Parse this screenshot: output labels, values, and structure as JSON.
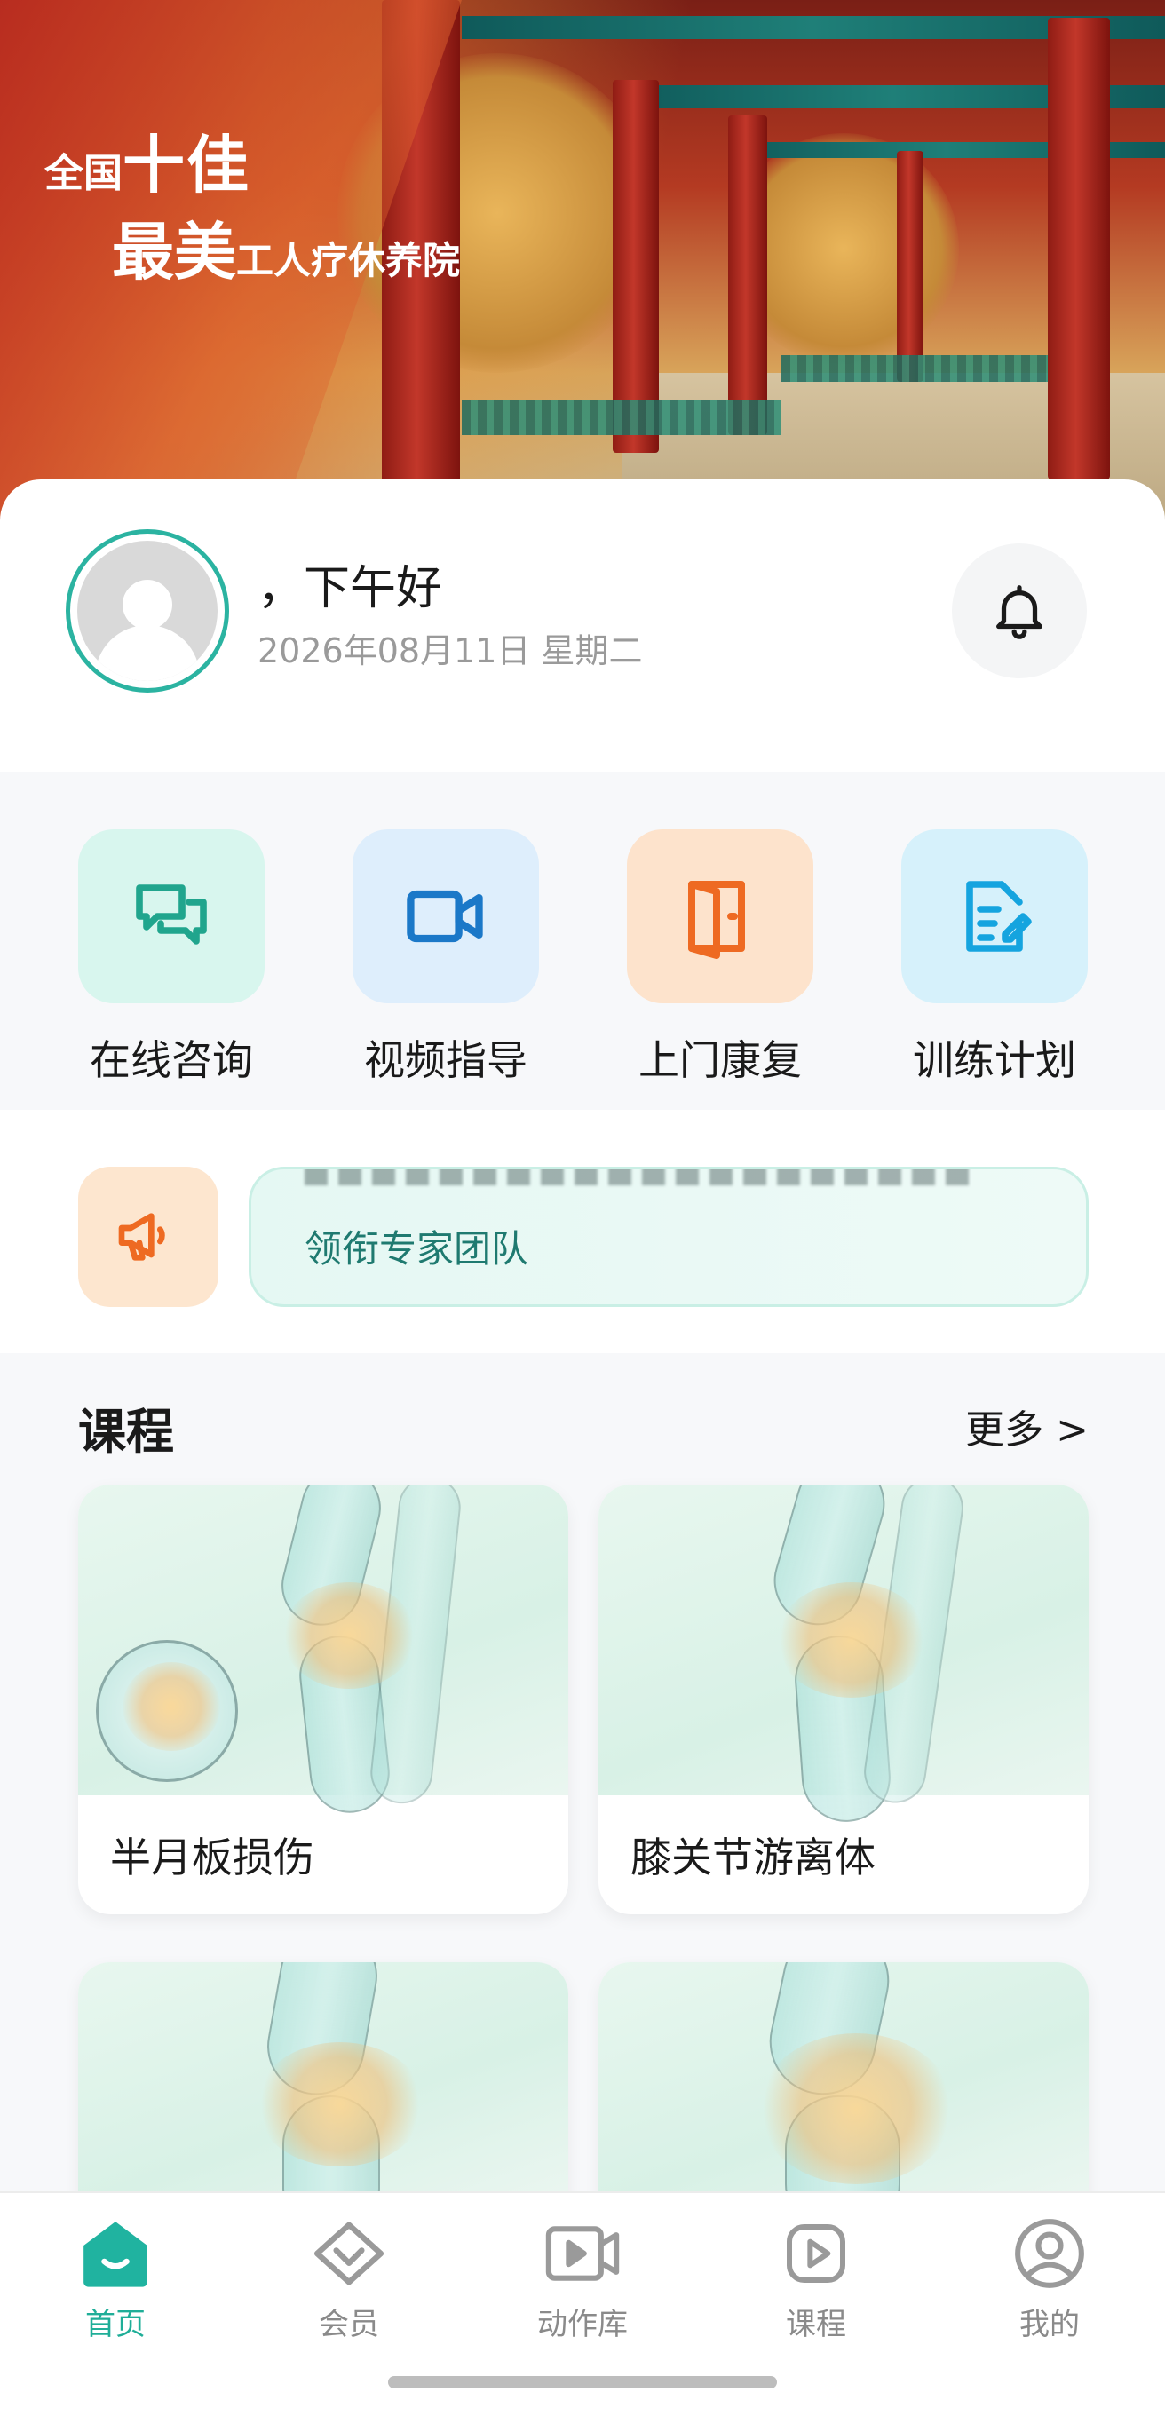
{
  "banner": {
    "line1_small": "全国",
    "line1_big": "十佳",
    "line2_big": "最美",
    "line2_small": "工人疗休养院"
  },
  "greeting": {
    "text": "，下午好",
    "date": "2026年08月11日 星期二"
  },
  "quick_actions": [
    {
      "label": "在线咨询",
      "icon": "chat-icon",
      "bg": "#d8f6ee",
      "color": "#20a58d"
    },
    {
      "label": "视频指导",
      "icon": "video-camera-icon",
      "bg": "#deeefc",
      "color": "#1b78c8"
    },
    {
      "label": "上门康复",
      "icon": "door-icon",
      "bg": "#fde3cc",
      "color": "#ee6a22"
    },
    {
      "label": "训练计划",
      "icon": "edit-document-icon",
      "bg": "#d6f1fb",
      "color": "#15a4df"
    }
  ],
  "notice": {
    "icon": "megaphone-icon",
    "text": "领衔专家团队"
  },
  "courses": {
    "title": "课程",
    "more": "更多 >",
    "items": [
      {
        "title": "半月板损伤",
        "image": "meniscus-injury-illustration"
      },
      {
        "title": "膝关节游离体",
        "image": "knee-loose-body-illustration"
      },
      {
        "title": "",
        "image": "knee-joint-illustration"
      },
      {
        "title": "",
        "image": "knee-arthritis-illustration"
      }
    ]
  },
  "tabbar": [
    {
      "label": "首页",
      "icon": "home-icon",
      "active": true
    },
    {
      "label": "会员",
      "icon": "member-diamond-icon",
      "active": false
    },
    {
      "label": "动作库",
      "icon": "video-library-icon",
      "active": false
    },
    {
      "label": "课程",
      "icon": "play-course-icon",
      "active": false
    },
    {
      "label": "我的",
      "icon": "profile-icon",
      "active": false
    }
  ],
  "colors": {
    "accent": "#1fae98",
    "avatar_ring": "#2bb3a1"
  }
}
